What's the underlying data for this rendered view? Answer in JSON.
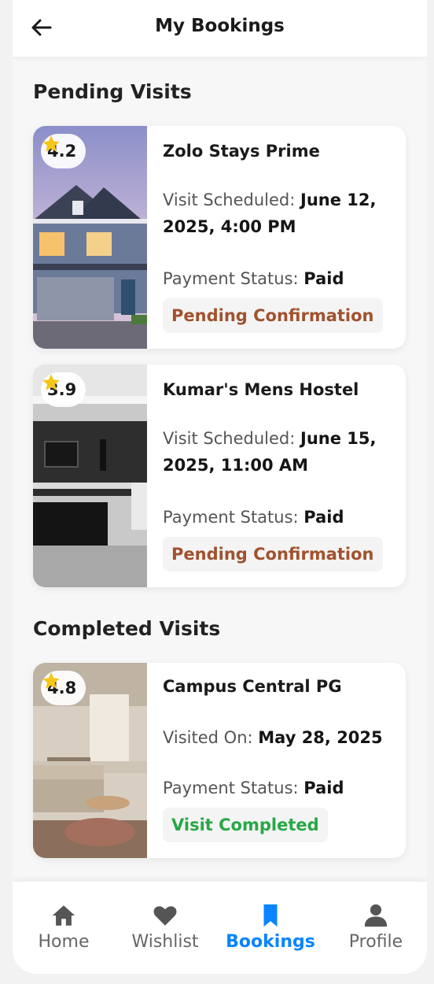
{
  "header": {
    "title": "My Bookings",
    "back_icon": "arrow-left-icon"
  },
  "sections": {
    "pending_title": "Pending Visits",
    "completed_title": "Completed Visits"
  },
  "bookings": [
    {
      "name": "Zolo Stays Prime",
      "rating": "4.2",
      "visit_label": "Visit Scheduled: ",
      "visit_line1": "June 12,",
      "visit_line2": "2025, 4:00 PM",
      "payment_label": "Payment Status: ",
      "payment_value": "Paid",
      "status": "Pending Confirmation",
      "status_color": "#a0522d"
    },
    {
      "name": "Kumar's Mens Hostel",
      "rating": "3.9",
      "visit_label": "Visit Scheduled: ",
      "visit_line1": "June 15,",
      "visit_line2": "2025, 11:00 AM",
      "payment_label": "Payment Status: ",
      "payment_value": "Paid",
      "status": "Pending Confirmation",
      "status_color": "#a0522d"
    },
    {
      "name": "Campus Central PG",
      "rating": "4.8",
      "visit_label": "Visited On: ",
      "visit_line1": "May 28, 2025",
      "visit_line2": "",
      "payment_label": "Payment Status: ",
      "payment_value": "Paid",
      "status": "Visit Completed",
      "status_color": "#28a745"
    }
  ],
  "nav": {
    "items": [
      {
        "label": "Home",
        "icon": "home-icon",
        "active": false
      },
      {
        "label": "Wishlist",
        "icon": "heart-icon",
        "active": false
      },
      {
        "label": "Bookings",
        "icon": "bookmark-icon",
        "active": true
      },
      {
        "label": "Profile",
        "icon": "user-icon",
        "active": false
      }
    ],
    "active_color": "#0a84ff",
    "inactive_color": "#555555"
  },
  "colors": {
    "star": "#f5c518"
  }
}
